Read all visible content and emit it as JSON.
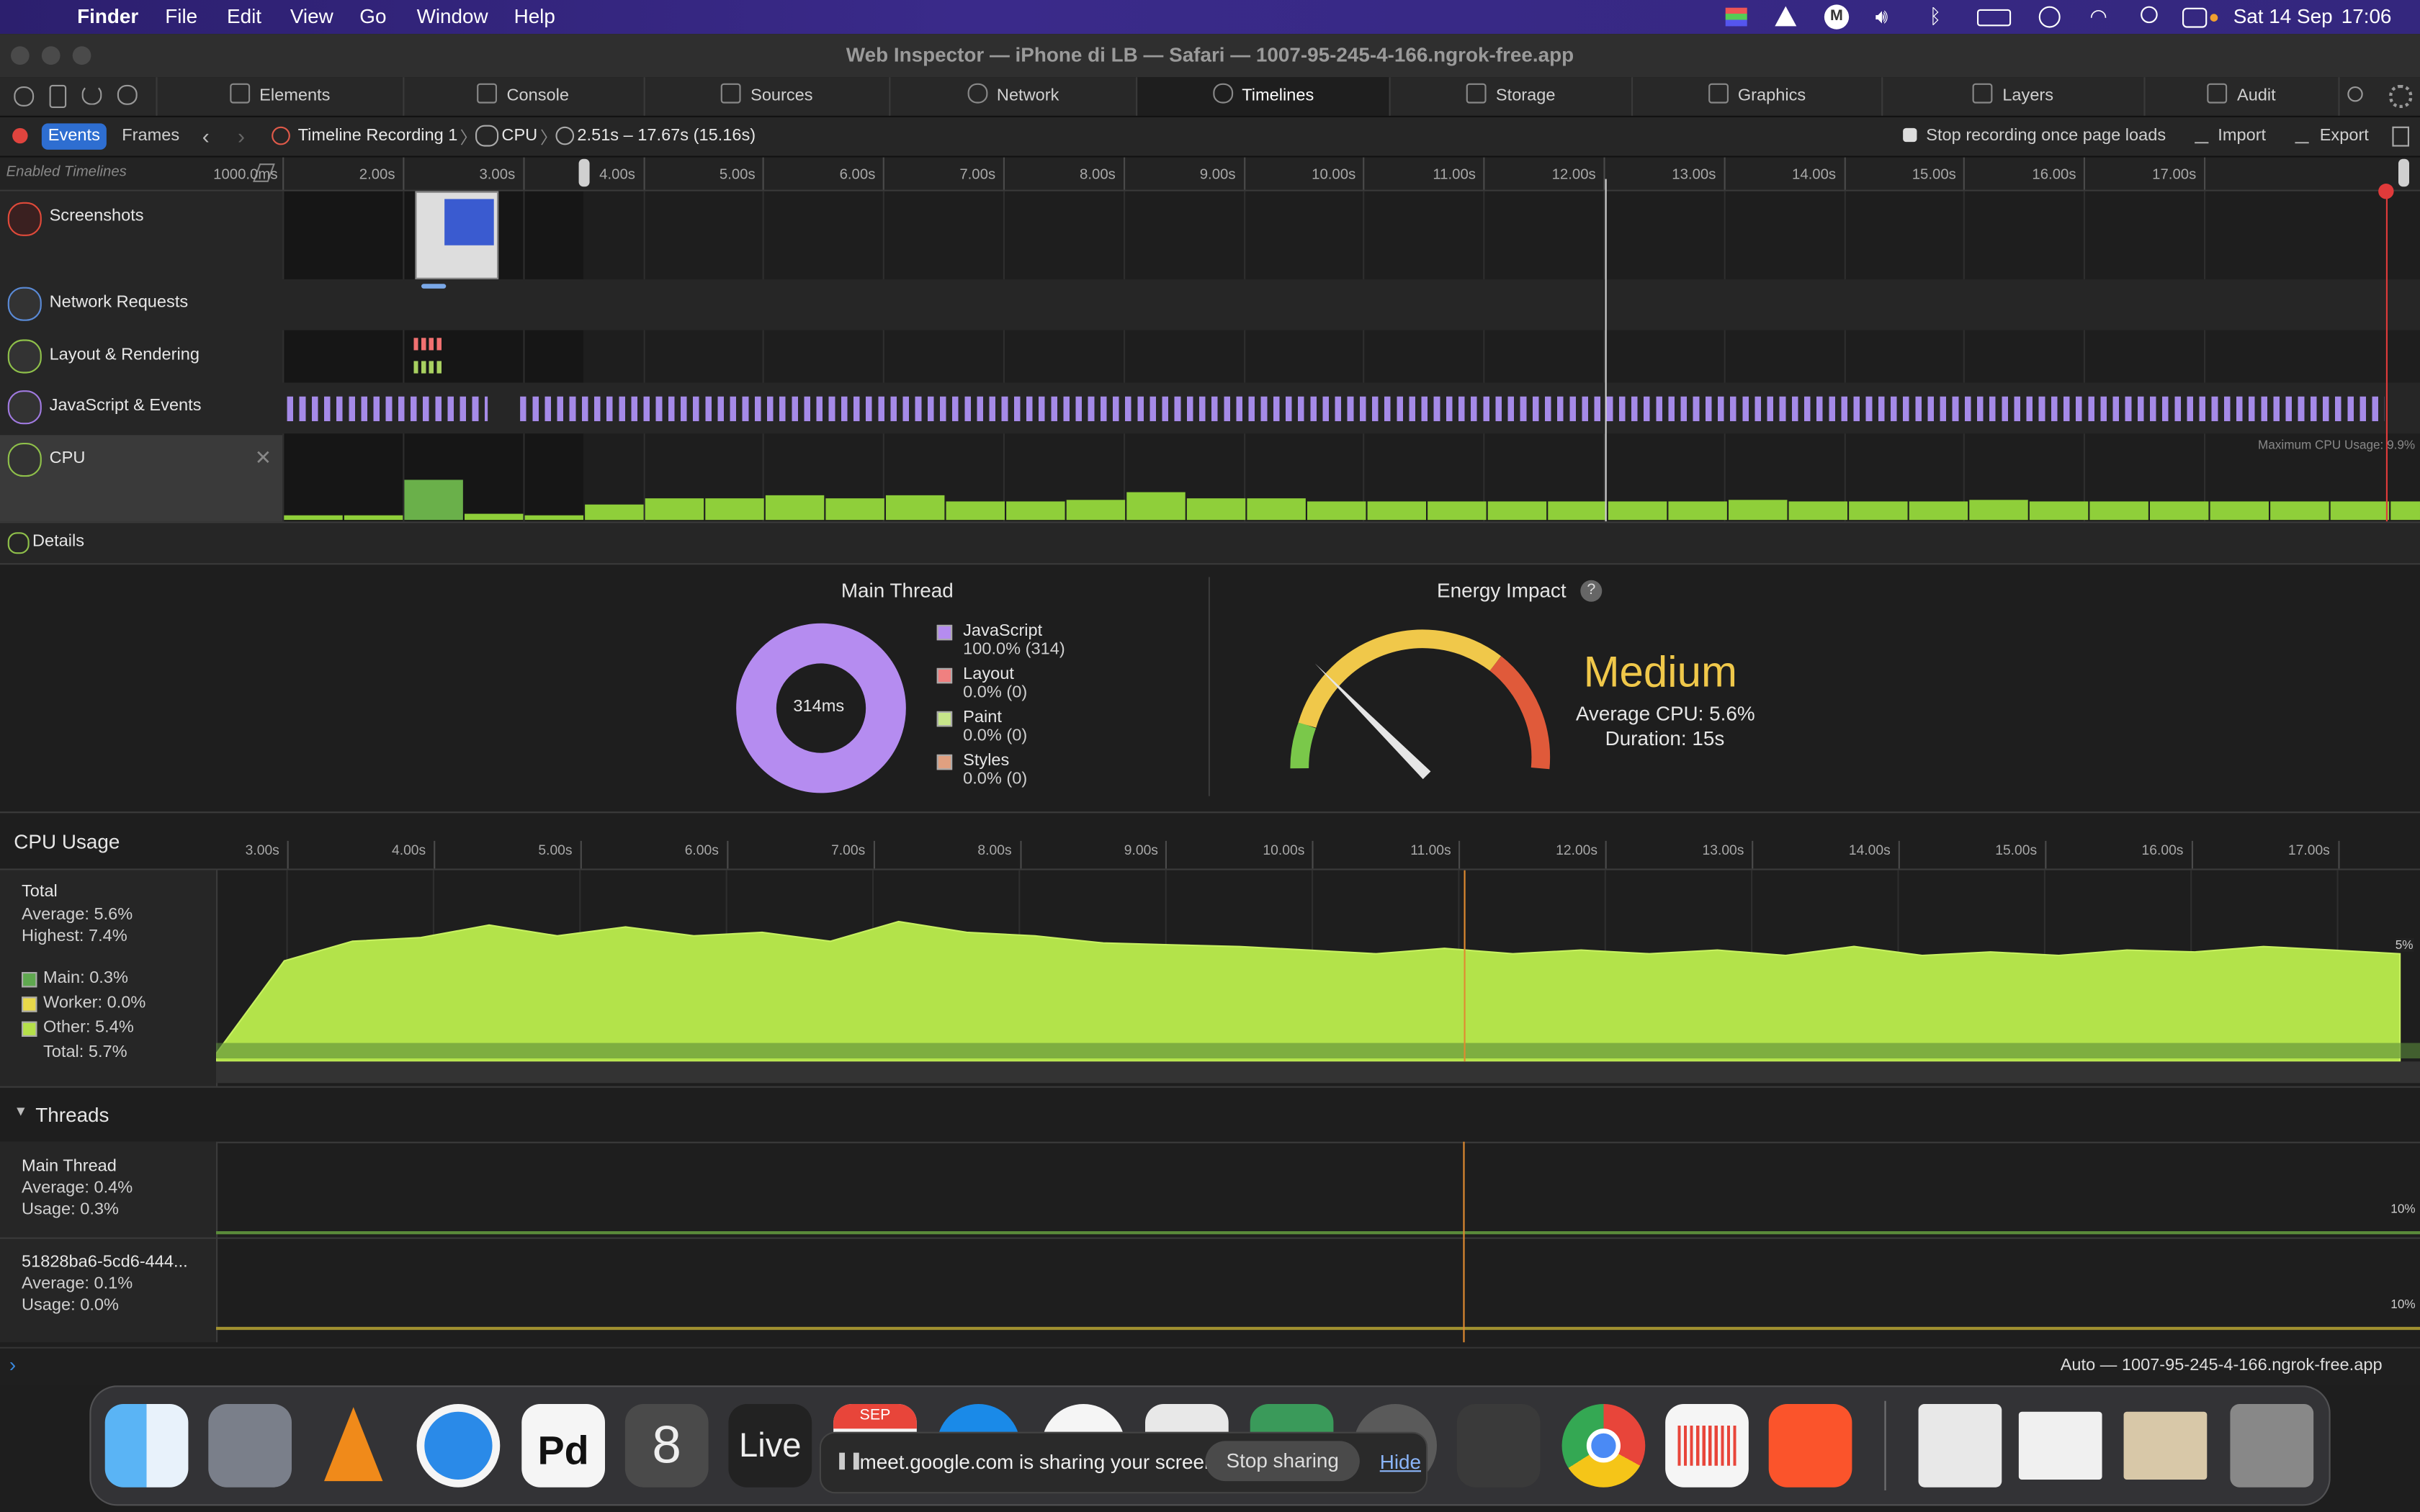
{
  "menubar": {
    "app": "Finder",
    "items": [
      "File",
      "Edit",
      "View",
      "Go",
      "Window",
      "Help"
    ],
    "date": "Sat 14 Sep",
    "time": "17:06"
  },
  "window": {
    "title": "Web Inspector — iPhone di LB — Safari — 1007-95-245-4-166.ngrok-free.app"
  },
  "tabs": [
    "Elements",
    "Console",
    "Sources",
    "Network",
    "Timelines",
    "Storage",
    "Graphics",
    "Layers",
    "Audit"
  ],
  "toolbar": {
    "events": "Events",
    "frames": "Frames",
    "recording": "Timeline Recording 1",
    "cpu": "CPU",
    "range": "2.51s – 17.67s (15.16s)",
    "stop_recording": "Stop recording once page loads",
    "import": "Import",
    "export": "Export"
  },
  "ruler": {
    "enabled_timelines": "Enabled Timelines",
    "ticks": [
      "1000.0ms",
      "2.00s",
      "3.00s",
      "4.00s",
      "5.00s",
      "6.00s",
      "7.00s",
      "8.00s",
      "9.00s",
      "10.00s",
      "11.00s",
      "12.00s",
      "13.00s",
      "14.00s",
      "15.00s",
      "16.00s",
      "17.00s"
    ]
  },
  "timelines": [
    "Screenshots",
    "Network Requests",
    "Layout & Rendering",
    "JavaScript & Events",
    "CPU"
  ],
  "cpu_max_label": "Maximum CPU Usage: 9.9%",
  "details": {
    "title": "Details",
    "main_thread": {
      "title": "Main Thread",
      "center": "314ms",
      "legend": [
        {
          "name": "JavaScript",
          "value": "100.0% (314)",
          "color": "#b58cf0"
        },
        {
          "name": "Layout",
          "value": "0.0% (0)",
          "color": "#f08080"
        },
        {
          "name": "Paint",
          "value": "0.0% (0)",
          "color": "#c7e68a"
        },
        {
          "name": "Styles",
          "value": "0.0% (0)",
          "color": "#e0a080"
        }
      ]
    },
    "energy": {
      "title": "Energy Impact",
      "help": "?",
      "level": "Medium",
      "average": "Average CPU: 5.6%",
      "duration": "Duration: 15s",
      "gauge_fraction": 0.42
    }
  },
  "cpu_usage": {
    "title": "CPU Usage",
    "ticks": [
      "3.00s",
      "4.00s",
      "5.00s",
      "6.00s",
      "7.00s",
      "8.00s",
      "9.00s",
      "10.00s",
      "11.00s",
      "12.00s",
      "13.00s",
      "14.00s",
      "15.00s",
      "16.00s",
      "17.00s"
    ],
    "total": "Total",
    "average": "Average: 5.6%",
    "highest": "Highest: 7.4%",
    "legend": [
      {
        "name": "Main: 0.3%",
        "color": "#5fa84f"
      },
      {
        "name": "Worker: 0.0%",
        "color": "#e8d84a"
      },
      {
        "name": "Other: 5.4%",
        "color": "#b5e04a"
      }
    ],
    "total_line": "Total: 5.7%",
    "side_label": "5%"
  },
  "threads": {
    "title": "Threads",
    "items": [
      {
        "name": "Main Thread",
        "average": "Average: 0.4%",
        "usage": "Usage: 0.3%",
        "scale": "10%"
      },
      {
        "name": "51828ba6-5cd6-444...",
        "average": "Average: 0.1%",
        "usage": "Usage: 0.0%",
        "scale": "10%"
      }
    ]
  },
  "status": {
    "context": "Auto — 1007-95-245-4-166.ngrok-free.app"
  },
  "dock": {
    "live": "Live",
    "cal_month": "SEP",
    "share_text": "meet.google.com is sharing your screen.",
    "stop_sharing": "Stop sharing",
    "hide": "Hide"
  }
}
